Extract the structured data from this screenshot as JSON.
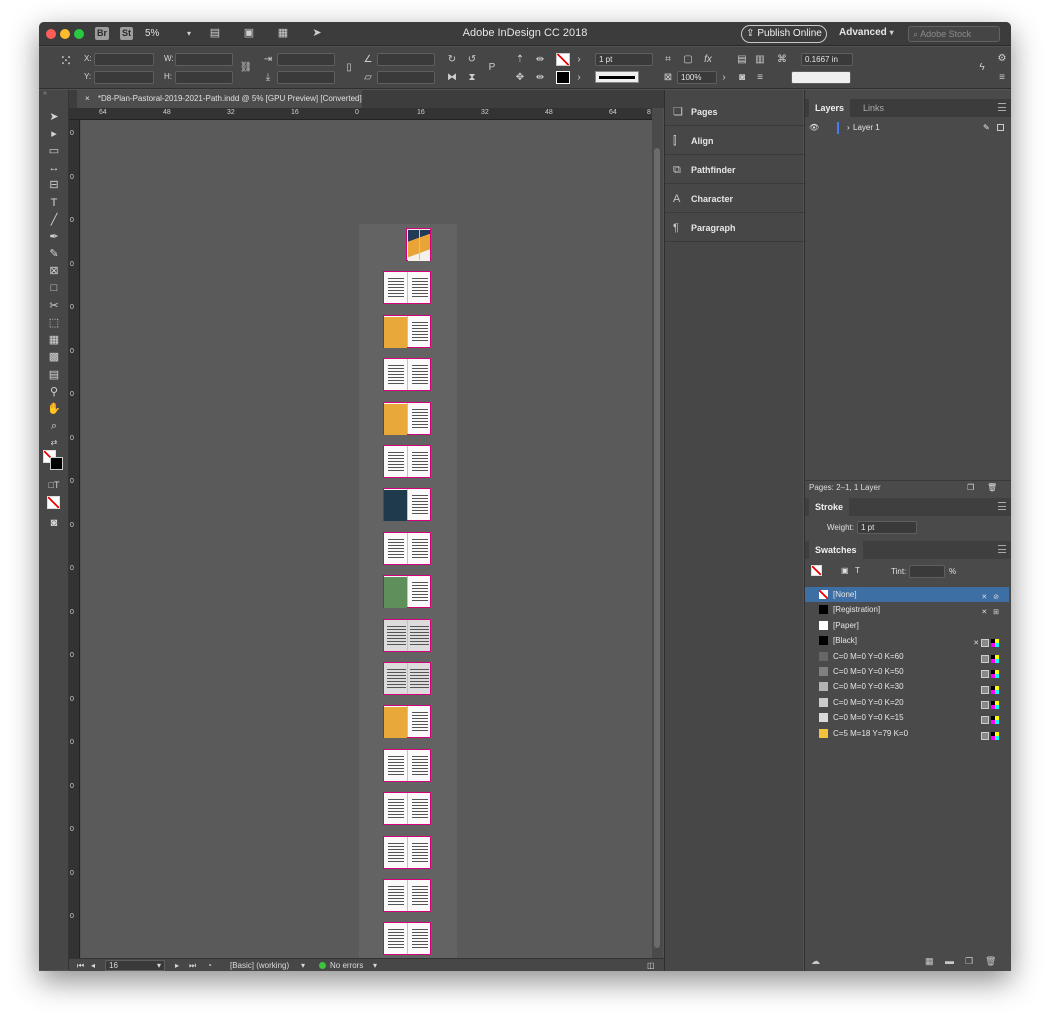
{
  "window": {
    "title": "Adobe InDesign CC 2018",
    "bridge_label": "Br",
    "stock_label": "St",
    "zoom": "5%",
    "publish_label": "Publish Online",
    "workspace": "Advanced",
    "search_placeholder": "Adobe Stock"
  },
  "control": {
    "x_label": "X:",
    "y_label": "Y:",
    "w_label": "W:",
    "h_label": "H:",
    "stroke_weight": "1 pt",
    "opacity": "100%",
    "offset": "0.1667 in"
  },
  "document": {
    "tab_title": "*D8-Plan-Pastoral-2019-2021-Path.indd @ 5% [GPU Preview] [Converted]",
    "close_glyph": "×"
  },
  "ruler": {
    "top_ticks": [
      "64",
      "48",
      "32",
      "16",
      "0",
      "16",
      "32",
      "48",
      "64",
      "8"
    ],
    "left_ticks": [
      "0",
      "0",
      "0",
      "0",
      "0",
      "0",
      "0",
      "0",
      "0",
      "0",
      "0",
      "0",
      "0",
      "0",
      "0",
      "0",
      "0",
      "0",
      "0"
    ]
  },
  "spreads": [
    {
      "type": "cover"
    },
    {
      "type": "text"
    },
    {
      "type": "image",
      "color": "#e9a93a"
    },
    {
      "type": "text"
    },
    {
      "type": "image",
      "color": "#e9a93a"
    },
    {
      "type": "text"
    },
    {
      "type": "image",
      "color": "#1f3a4d"
    },
    {
      "type": "text"
    },
    {
      "type": "image",
      "color": "#5f8f5a"
    },
    {
      "type": "grey"
    },
    {
      "type": "grey"
    },
    {
      "type": "image",
      "color": "#e9a93a"
    },
    {
      "type": "text"
    },
    {
      "type": "text"
    },
    {
      "type": "text"
    },
    {
      "type": "text"
    },
    {
      "type": "text"
    },
    {
      "type": "blank"
    },
    {
      "type": "back"
    }
  ],
  "status": {
    "page": "16",
    "preflight_profile": "[Basic] (working)",
    "errors": "No errors"
  },
  "panels": {
    "collapsed": [
      "Pages",
      "Align",
      "Pathfinder",
      "Character",
      "Paragraph"
    ],
    "layers": {
      "tab_active": "Layers",
      "tab_inactive": "Links",
      "layer_name": "Layer 1",
      "footer": "Pages: 2–1, 1 Layer"
    },
    "stroke": {
      "title": "Stroke",
      "weight_label": "Weight:",
      "weight_value": "1 pt"
    },
    "swatches": {
      "title": "Swatches",
      "tint_label": "Tint:",
      "tint_unit": "%",
      "items": [
        {
          "name": "[None]",
          "color": "none",
          "selected": true
        },
        {
          "name": "[Registration]",
          "color": "#000000"
        },
        {
          "name": "[Paper]",
          "color": "#ffffff"
        },
        {
          "name": "[Black]",
          "color": "#000000"
        },
        {
          "name": "C=0 M=0 Y=0 K=60",
          "color": "#666666"
        },
        {
          "name": "C=0 M=0 Y=0 K=50",
          "color": "#808080"
        },
        {
          "name": "C=0 M=0 Y=0 K=30",
          "color": "#b3b3b3"
        },
        {
          "name": "C=0 M=0 Y=0 K=20",
          "color": "#cccccc"
        },
        {
          "name": "C=0 M=0 Y=0 K=15",
          "color": "#d9d9d9"
        },
        {
          "name": "C=5 M=18 Y=79 K=0",
          "color": "#f2c23c"
        }
      ]
    }
  }
}
